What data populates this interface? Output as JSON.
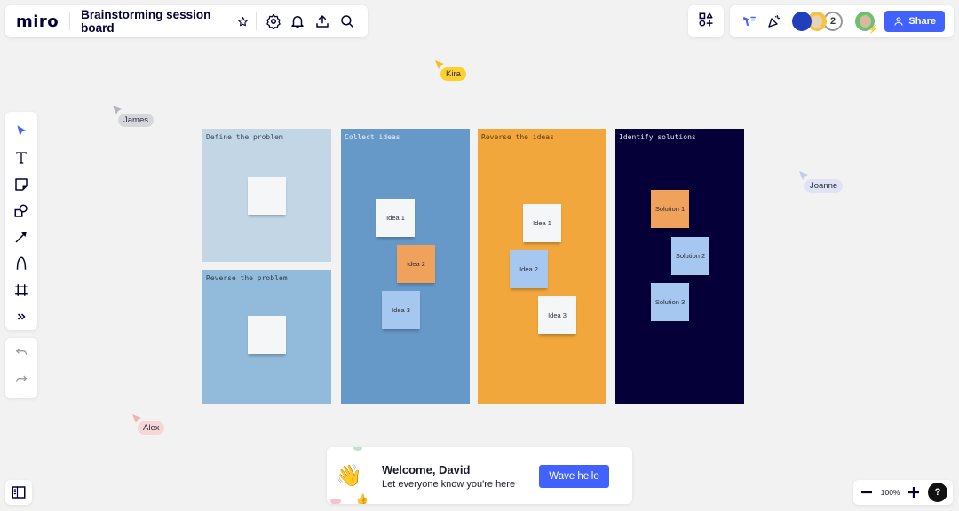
{
  "app": {
    "logo": "miro",
    "board_title": "Brainstorming session board"
  },
  "topbar": {
    "left_icons": [
      "star-icon",
      "settings-icon",
      "bell-icon",
      "upload-icon",
      "search-icon"
    ],
    "right_icons": [
      "apps-icon",
      "reactions-icon",
      "celebrate-icon"
    ],
    "collaborator_overflow_count": "2",
    "share_label": "Share"
  },
  "toolbar": {
    "tools": [
      "select-tool",
      "text-tool",
      "sticky-note-tool",
      "shapes-tool",
      "arrow-tool",
      "pen-tool",
      "frame-tool",
      "more-tools"
    ],
    "undo": "undo",
    "redo": "redo"
  },
  "cursors": [
    {
      "name": "Kira",
      "color": "#fdd02b",
      "arrow": "#f5c21b"
    },
    {
      "name": "James",
      "color": "#d6d6dd",
      "arrow": "#b5b5bd"
    },
    {
      "name": "Joanne",
      "color": "#dfe3f5",
      "arrow": "#c5cbe8"
    },
    {
      "name": "Alex",
      "color": "#f6d6d8",
      "arrow": "#efb3b8"
    }
  ],
  "frames": [
    {
      "title": "Define the problem",
      "bg": "#c3d6e6",
      "text_color": "#3a4a5a"
    },
    {
      "title": "Reverse the problem",
      "bg": "#92bbdb",
      "text_color": "#2e3e52"
    },
    {
      "title": "Collect ideas",
      "bg": "#6699c8",
      "text_color": "#e8f0f8"
    },
    {
      "title": "Reverse the ideas",
      "bg": "#f2a73c",
      "text_color": "#5a3a10"
    },
    {
      "title": "Identify solutions",
      "bg": "#050038",
      "text_color": "#e6e6f0"
    }
  ],
  "stickies": [
    {
      "frame": "Define the problem",
      "label": "",
      "color": "#f5f6f8"
    },
    {
      "frame": "Reverse the problem",
      "label": "",
      "color": "#f5f6f8"
    },
    {
      "frame": "Collect ideas",
      "label": "Idea 1",
      "color": "#f5f6f8"
    },
    {
      "frame": "Collect ideas",
      "label": "Idea 2",
      "color": "#f0a25d"
    },
    {
      "frame": "Collect ideas",
      "label": "Idea 3",
      "color": "#a6c8f0"
    },
    {
      "frame": "Reverse the ideas",
      "label": "Idea 1",
      "color": "#f5f6f8"
    },
    {
      "frame": "Reverse the ideas",
      "label": "Idea 2",
      "color": "#a6c8f0"
    },
    {
      "frame": "Reverse the ideas",
      "label": "Idea 3",
      "color": "#f5f6f8"
    },
    {
      "frame": "Identify solutions",
      "label": "Solution 1",
      "color": "#f0a25d"
    },
    {
      "frame": "Identify solutions",
      "label": "Solution 2",
      "color": "#a6c8f0"
    },
    {
      "frame": "Identify solutions",
      "label": "Solution 3",
      "color": "#a6c8f0"
    }
  ],
  "welcome": {
    "title": "Welcome, David",
    "subtitle": "Let everyone know you're here",
    "button_label": "Wave hello"
  },
  "zoom": {
    "level": "100%",
    "help": "?"
  },
  "colors": {
    "accent": "#4262ff",
    "canvas": "#f2f2f2"
  }
}
